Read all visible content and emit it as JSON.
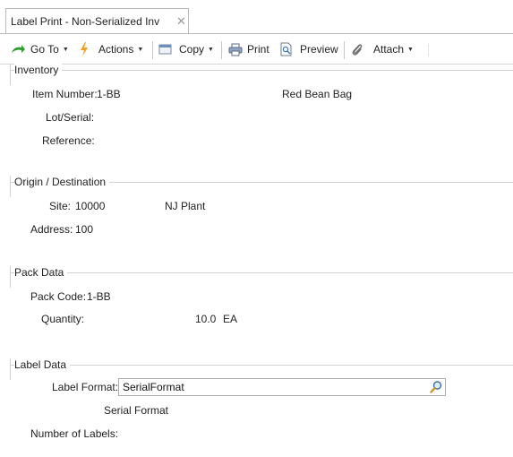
{
  "tab": {
    "title": "Label Print - Non-Serialized Inv",
    "close_glyph": "✕"
  },
  "toolbar": {
    "goto_label": "Go To",
    "actions_label": "Actions",
    "copy_label": "Copy",
    "print_label": "Print",
    "preview_label": "Preview",
    "attach_label": "Attach"
  },
  "inventory": {
    "title": "Inventory",
    "item_number_label": "Item Number:",
    "item_number_value": "1-BB",
    "item_description": "Red Bean Bag",
    "lot_serial_label": "Lot/Serial:",
    "reference_label": "Reference:"
  },
  "origin": {
    "title": "Origin / Destination",
    "site_label": "Site:",
    "site_value": "10000",
    "site_name": "NJ Plant",
    "address_label": "Address:",
    "address_value": "100"
  },
  "pack": {
    "title": "Pack Data",
    "pack_code_label": "Pack Code:",
    "pack_code_value": "1-BB",
    "quantity_label": "Quantity:",
    "quantity_value": "10.0",
    "quantity_uom": "EA"
  },
  "label_data": {
    "title": "Label Data",
    "label_format_label": "Label Format:",
    "label_format_value": "SerialFormat",
    "label_format_description": "Serial Format",
    "number_of_labels_label": "Number of Labels:"
  },
  "colors": {
    "accent_green": "#2e9e2e",
    "accent_orange": "#f0a020",
    "border": "#b9b9b9"
  },
  "icons": [
    "goto-icon",
    "actions-icon",
    "copy-icon",
    "print-icon",
    "preview-icon",
    "attach-icon",
    "search-icon"
  ]
}
